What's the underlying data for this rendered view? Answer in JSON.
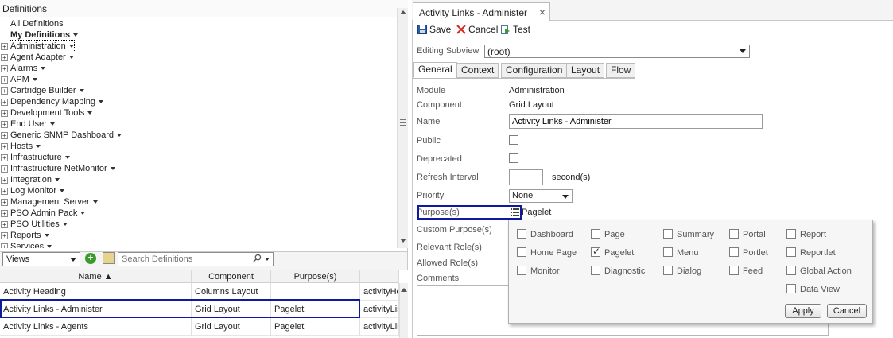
{
  "left": {
    "header": "Definitions",
    "tree": [
      {
        "label": "All Definitions",
        "expander": false,
        "caret": false,
        "bold": false,
        "selected": false
      },
      {
        "label": "My Definitions",
        "expander": false,
        "caret": true,
        "bold": true,
        "selected": false
      },
      {
        "label": "Administration",
        "expander": true,
        "caret": true,
        "bold": false,
        "selected": true
      },
      {
        "label": "Agent Adapter",
        "expander": true,
        "caret": true,
        "bold": false,
        "selected": false
      },
      {
        "label": "Alarms",
        "expander": true,
        "caret": true,
        "bold": false,
        "selected": false
      },
      {
        "label": "APM",
        "expander": true,
        "caret": true,
        "bold": false,
        "selected": false
      },
      {
        "label": "Cartridge Builder",
        "expander": true,
        "caret": true,
        "bold": false,
        "selected": false
      },
      {
        "label": "Dependency Mapping",
        "expander": true,
        "caret": true,
        "bold": false,
        "selected": false
      },
      {
        "label": "Development Tools",
        "expander": true,
        "caret": true,
        "bold": false,
        "selected": false
      },
      {
        "label": "End User",
        "expander": true,
        "caret": true,
        "bold": false,
        "selected": false
      },
      {
        "label": "Generic SNMP Dashboard",
        "expander": true,
        "caret": true,
        "bold": false,
        "selected": false
      },
      {
        "label": "Hosts",
        "expander": true,
        "caret": true,
        "bold": false,
        "selected": false
      },
      {
        "label": "Infrastructure",
        "expander": true,
        "caret": true,
        "bold": false,
        "selected": false
      },
      {
        "label": "Infrastructure NetMonitor",
        "expander": true,
        "caret": true,
        "bold": false,
        "selected": false
      },
      {
        "label": "Integration",
        "expander": true,
        "caret": true,
        "bold": false,
        "selected": false
      },
      {
        "label": "Log Monitor",
        "expander": true,
        "caret": true,
        "bold": false,
        "selected": false
      },
      {
        "label": "Management Server",
        "expander": true,
        "caret": true,
        "bold": false,
        "selected": false
      },
      {
        "label": "PSO Admin Pack",
        "expander": true,
        "caret": true,
        "bold": false,
        "selected": false
      },
      {
        "label": "PSO Utilities",
        "expander": true,
        "caret": true,
        "bold": false,
        "selected": false
      },
      {
        "label": "Reports",
        "expander": true,
        "caret": true,
        "bold": false,
        "selected": false
      },
      {
        "label": "Services",
        "expander": true,
        "caret": true,
        "bold": false,
        "selected": false
      }
    ],
    "views_select": "Views",
    "search_placeholder": "Search Definitions",
    "grid": {
      "columns": [
        "Name ▲",
        "Component",
        "Purpose(s)",
        ""
      ],
      "rows": [
        {
          "name": "Activity Heading",
          "component": "Columns Layout",
          "purpose": "",
          "extra": "activityHe"
        },
        {
          "name": "Activity Links - Administer",
          "component": "Grid Layout",
          "purpose": "Pagelet",
          "extra": "activityLin"
        },
        {
          "name": "Activity Links - Agents",
          "component": "Grid Layout",
          "purpose": "Pagelet",
          "extra": "activityLin"
        }
      ]
    }
  },
  "right": {
    "doc_tab": "Activity Links - Administer",
    "toolbar": {
      "save": "Save",
      "cancel": "Cancel",
      "test": "Test"
    },
    "editing_subview_label": "Editing Subview",
    "editing_subview_value": "(root)",
    "tabs": [
      "General",
      "Context",
      "Configuration",
      "Layout",
      "Flow"
    ],
    "active_tab": "General",
    "form": {
      "module_label": "Module",
      "module_value": "Administration",
      "component_label": "Component",
      "component_value": "Grid Layout",
      "name_label": "Name",
      "name_value": "Activity Links - Administer",
      "public_label": "Public",
      "deprecated_label": "Deprecated",
      "refresh_label": "Refresh Interval",
      "refresh_value": "",
      "refresh_unit": "second(s)",
      "priority_label": "Priority",
      "priority_value": "None",
      "purpose_label": "Purpose(s)",
      "purpose_value": "Pagelet",
      "custom_purpose_label": "Custom Purpose(s)",
      "relevant_roles_label": "Relevant Role(s)",
      "allowed_roles_label": "Allowed Role(s)",
      "comments_label": "Comments"
    },
    "purpose_popup": {
      "options": [
        {
          "label": "Dashboard",
          "checked": false
        },
        {
          "label": "Page",
          "checked": false
        },
        {
          "label": "Summary",
          "checked": false
        },
        {
          "label": "Portal",
          "checked": false
        },
        {
          "label": "Report",
          "checked": false
        },
        {
          "label": "Home Page",
          "checked": false
        },
        {
          "label": "Pagelet",
          "checked": true
        },
        {
          "label": "Menu",
          "checked": false
        },
        {
          "label": "Portlet",
          "checked": false
        },
        {
          "label": "Reportlet",
          "checked": false
        },
        {
          "label": "Monitor",
          "checked": false
        },
        {
          "label": "Diagnostic",
          "checked": false
        },
        {
          "label": "Dialog",
          "checked": false
        },
        {
          "label": "Feed",
          "checked": false
        },
        {
          "label": "Global Action",
          "checked": false
        },
        {
          "label": "Data View",
          "checked": false
        }
      ],
      "apply": "Apply",
      "cancel": "Cancel"
    }
  },
  "colors": {
    "highlight_border": "#0d1aa0",
    "add_icon": "#3a9a2c",
    "cancel_icon": "#d42a1e",
    "save_icon": "#2a5fa8"
  }
}
